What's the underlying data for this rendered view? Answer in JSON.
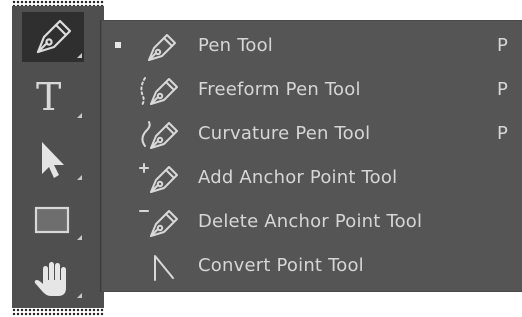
{
  "toolbar": {
    "tools": [
      {
        "icon": "pen-icon",
        "selected": true,
        "has_submenu": true
      },
      {
        "icon": "type-icon",
        "glyph": "T",
        "selected": false,
        "has_submenu": true
      },
      {
        "icon": "path-selection-icon",
        "selected": false,
        "has_submenu": true
      },
      {
        "icon": "rectangle-icon",
        "selected": false,
        "has_submenu": true
      },
      {
        "icon": "hand-icon",
        "selected": false,
        "has_submenu": true
      }
    ]
  },
  "flyout_menu": {
    "items": [
      {
        "label": "Pen Tool",
        "shortcut": "P",
        "active": true,
        "icon": "pen-icon"
      },
      {
        "label": "Freeform Pen Tool",
        "shortcut": "P",
        "active": false,
        "icon": "freeform-pen-icon"
      },
      {
        "label": "Curvature Pen Tool",
        "shortcut": "P",
        "active": false,
        "icon": "curvature-pen-icon"
      },
      {
        "label": "Add Anchor Point Tool",
        "shortcut": "",
        "active": false,
        "icon": "add-anchor-point-icon"
      },
      {
        "label": "Delete Anchor Point Tool",
        "shortcut": "",
        "active": false,
        "icon": "delete-anchor-point-icon"
      },
      {
        "label": "Convert Point Tool",
        "shortcut": "",
        "active": false,
        "icon": "convert-point-icon"
      }
    ]
  },
  "colors": {
    "toolbar_bg": "#4f4f4f",
    "selected_tool_bg": "#2f2f2f",
    "menu_bg": "#555555",
    "text": "#d6d6d6",
    "icon": "#d8d8d8"
  }
}
